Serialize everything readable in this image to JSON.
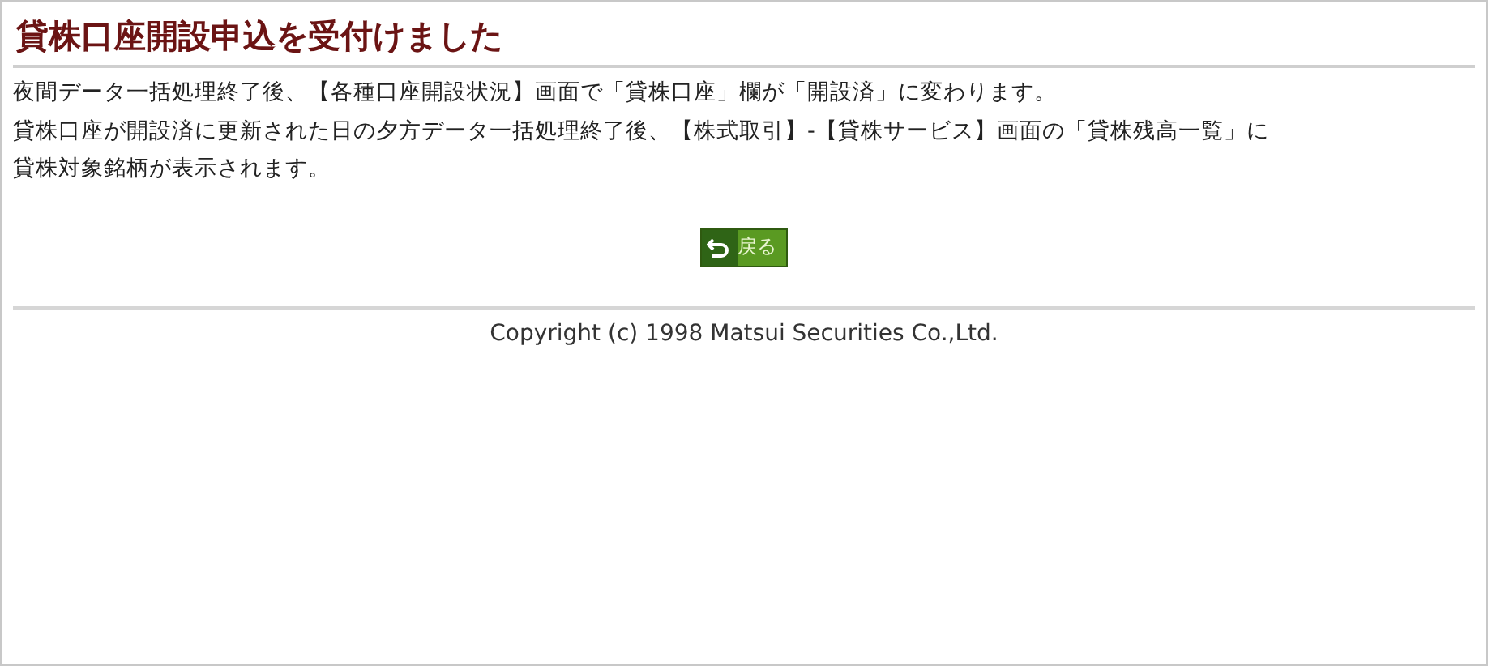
{
  "title": "貸株口座開設申込を受付けました",
  "message_lines": [
    "夜間データ一括処理終了後、【各種口座開設状況】画面で「貸株口座」欄が「開設済」に変わります。",
    "貸株口座が開設済に更新された日の夕方データ一括処理終了後、【株式取引】-【貸株サービス】画面の「貸株残高一覧」に",
    "貸株対象銘柄が表示されます。"
  ],
  "back_button": {
    "label": "戻る"
  },
  "footer": {
    "copyright": "Copyright (c) 1998 Matsui Securities Co.,Ltd."
  }
}
